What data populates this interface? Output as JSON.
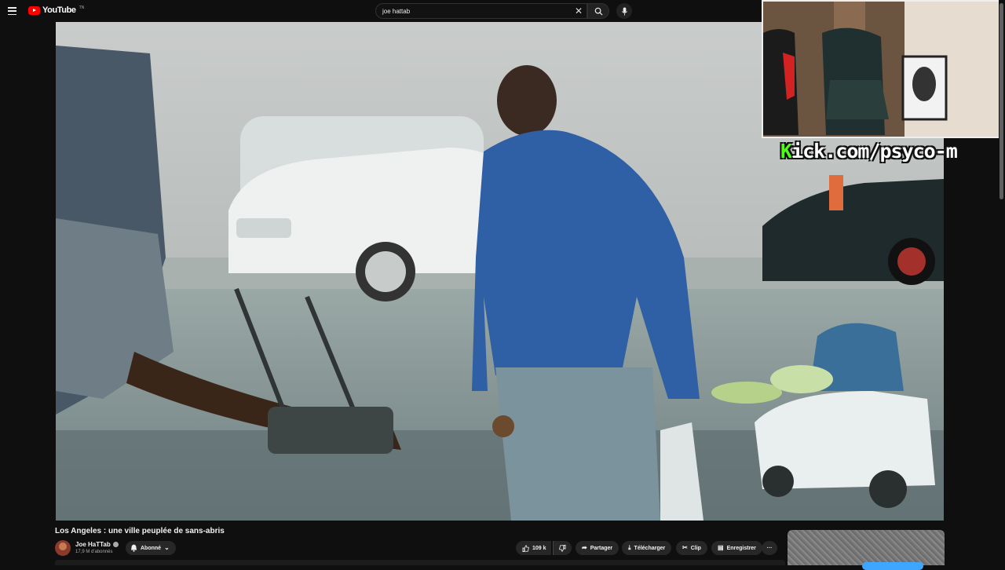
{
  "header": {
    "logo_text": "YouTube",
    "logo_sup": "TN",
    "search_value": "joe hattab"
  },
  "stream_overlay": {
    "kick_k": "K",
    "kick_rest": "ick.com/psyco-m"
  },
  "video": {
    "title": "Los Angeles : une ville peuplée de sans-abris"
  },
  "channel": {
    "name": "Joe HaTTab",
    "subscribers": "17,9 M d'abonnés",
    "subscribe_label": "Abonné"
  },
  "actions": {
    "likes": "109 k",
    "share": "Partager",
    "download": "Télécharger",
    "clip": "Clip",
    "save": "Enregistrer",
    "more": "···"
  },
  "icons": {
    "menu": "menu-icon",
    "search": "search-icon",
    "clear": "close-icon",
    "mic": "microphone-icon",
    "bell": "bell-icon",
    "like": "thumbs-up-icon",
    "dislike": "thumbs-down-icon",
    "share": "share-arrow-icon",
    "download": "download-icon",
    "clip": "scissors-icon",
    "save": "save-playlist-icon"
  },
  "colors": {
    "brand_red": "#ff0000",
    "kick_green": "#53fc18",
    "background": "#0f0f0f",
    "button_bg": "#272727",
    "sidebar_accent": "#3ea6ff"
  }
}
